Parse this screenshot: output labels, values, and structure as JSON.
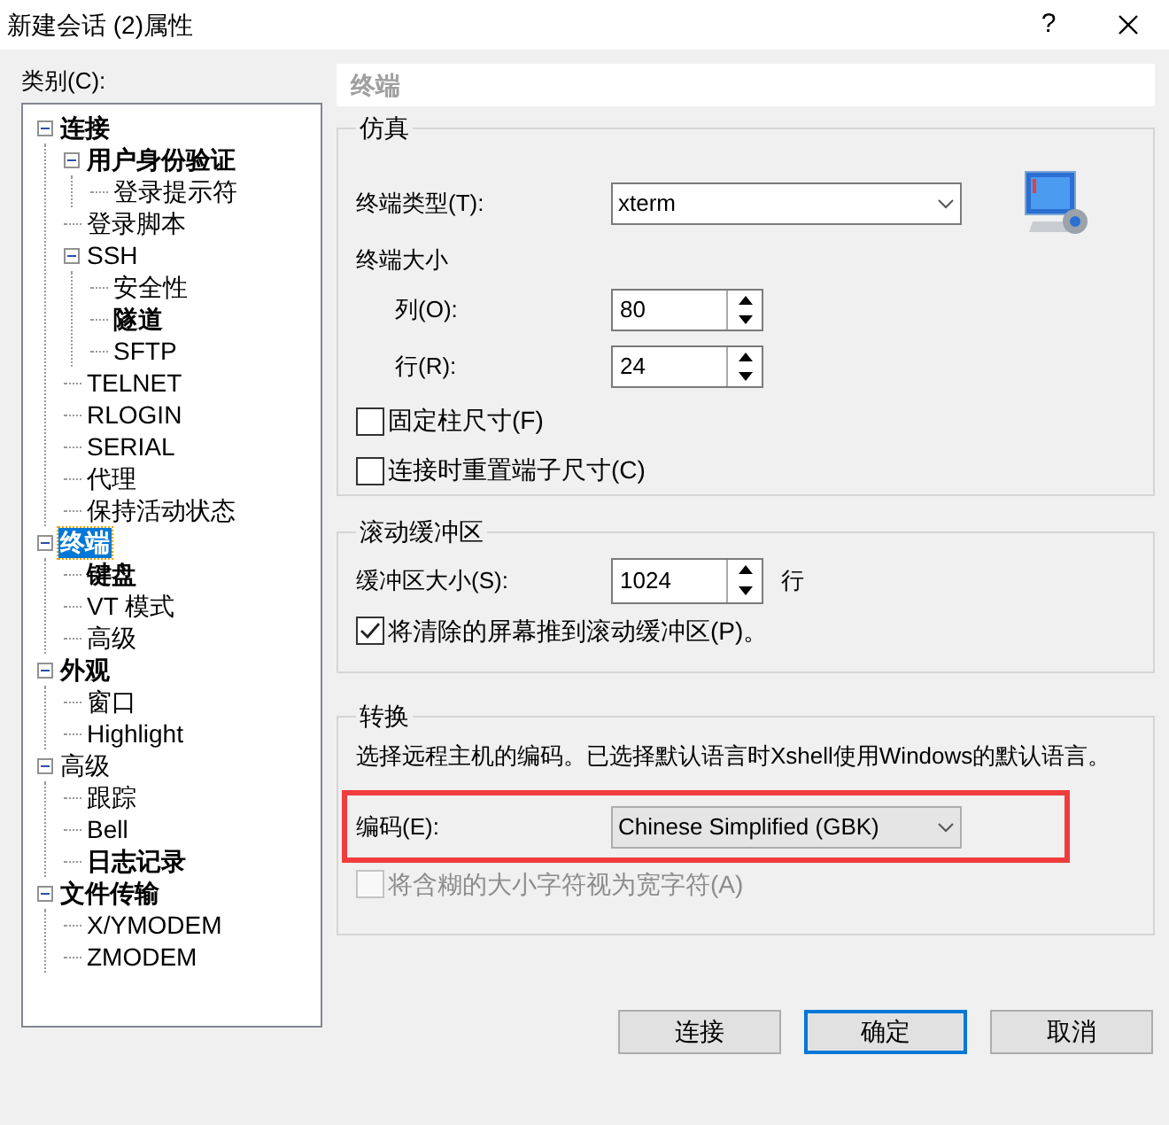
{
  "window": {
    "title": "新建会话 (2)属性",
    "help": "?"
  },
  "category_label": "类别(C):",
  "tree": [
    {
      "label": "连接",
      "bold": true,
      "selected": false,
      "expanded": true,
      "children": [
        {
          "label": "用户身份验证",
          "bold": true,
          "selected": false,
          "expanded": true,
          "children": [
            {
              "label": "登录提示符",
              "bold": false,
              "selected": false
            }
          ]
        },
        {
          "label": "登录脚本",
          "bold": false,
          "selected": false
        },
        {
          "label": "SSH",
          "bold": false,
          "selected": false,
          "expanded": true,
          "children": [
            {
              "label": "安全性",
              "bold": false,
              "selected": false
            },
            {
              "label": "隧道",
              "bold": true,
              "selected": false
            },
            {
              "label": "SFTP",
              "bold": false,
              "selected": false
            }
          ]
        },
        {
          "label": "TELNET",
          "bold": false,
          "selected": false
        },
        {
          "label": "RLOGIN",
          "bold": false,
          "selected": false
        },
        {
          "label": "SERIAL",
          "bold": false,
          "selected": false
        },
        {
          "label": "代理",
          "bold": false,
          "selected": false
        },
        {
          "label": "保持活动状态",
          "bold": false,
          "selected": false
        }
      ]
    },
    {
      "label": "终端",
      "bold": true,
      "selected": true,
      "expanded": true,
      "children": [
        {
          "label": "键盘",
          "bold": true,
          "selected": false
        },
        {
          "label": "VT 模式",
          "bold": false,
          "selected": false
        },
        {
          "label": "高级",
          "bold": false,
          "selected": false
        }
      ]
    },
    {
      "label": "外观",
      "bold": true,
      "selected": false,
      "expanded": true,
      "children": [
        {
          "label": "窗口",
          "bold": false,
          "selected": false
        },
        {
          "label": "Highlight",
          "bold": false,
          "selected": false
        }
      ]
    },
    {
      "label": "高级",
      "bold": false,
      "selected": false,
      "expanded": true,
      "children": [
        {
          "label": "跟踪",
          "bold": false,
          "selected": false
        },
        {
          "label": "Bell",
          "bold": false,
          "selected": false
        },
        {
          "label": "日志记录",
          "bold": true,
          "selected": false
        }
      ]
    },
    {
      "label": "文件传输",
      "bold": true,
      "selected": false,
      "expanded": true,
      "children": [
        {
          "label": "X/YMODEM",
          "bold": false,
          "selected": false
        },
        {
          "label": "ZMODEM",
          "bold": false,
          "selected": false
        }
      ]
    }
  ],
  "panel_title": "终端",
  "emulation": {
    "title": "仿真",
    "terminal_type_label": "终端类型(T):",
    "terminal_type": "xterm",
    "size_label": "终端大小",
    "columns_label": "列(O):",
    "columns": "80",
    "rows_label": "行(R):",
    "rows": "24",
    "checkboxes": [
      {
        "label": "固定柱尺寸(F)",
        "checked": false,
        "disabled": false
      },
      {
        "label": "连接时重置端子尺寸(C)",
        "checked": false,
        "disabled": false
      }
    ]
  },
  "scrollback": {
    "title": "滚动缓冲区",
    "size_label": "缓冲区大小(S):",
    "size": "1024",
    "unit": "行",
    "checkboxes": [
      {
        "label": "将清除的屏幕推到滚动缓冲区(P)。",
        "checked": true,
        "disabled": false
      }
    ]
  },
  "translation": {
    "title": "转换",
    "description": "选择远程主机的编码。已选择默认语言时Xshell使用Windows的默认语言。",
    "encoding_label": "编码(E):",
    "encoding": "Chinese Simplified (GBK)",
    "highlighted": true,
    "checkboxes": [
      {
        "label": "将含糊的大小字符视为宽字符(A)",
        "checked": false,
        "disabled": true
      }
    ]
  },
  "buttons": [
    {
      "label": "连接",
      "default": false
    },
    {
      "label": "确定",
      "default": true
    },
    {
      "label": "取消",
      "default": false
    }
  ]
}
